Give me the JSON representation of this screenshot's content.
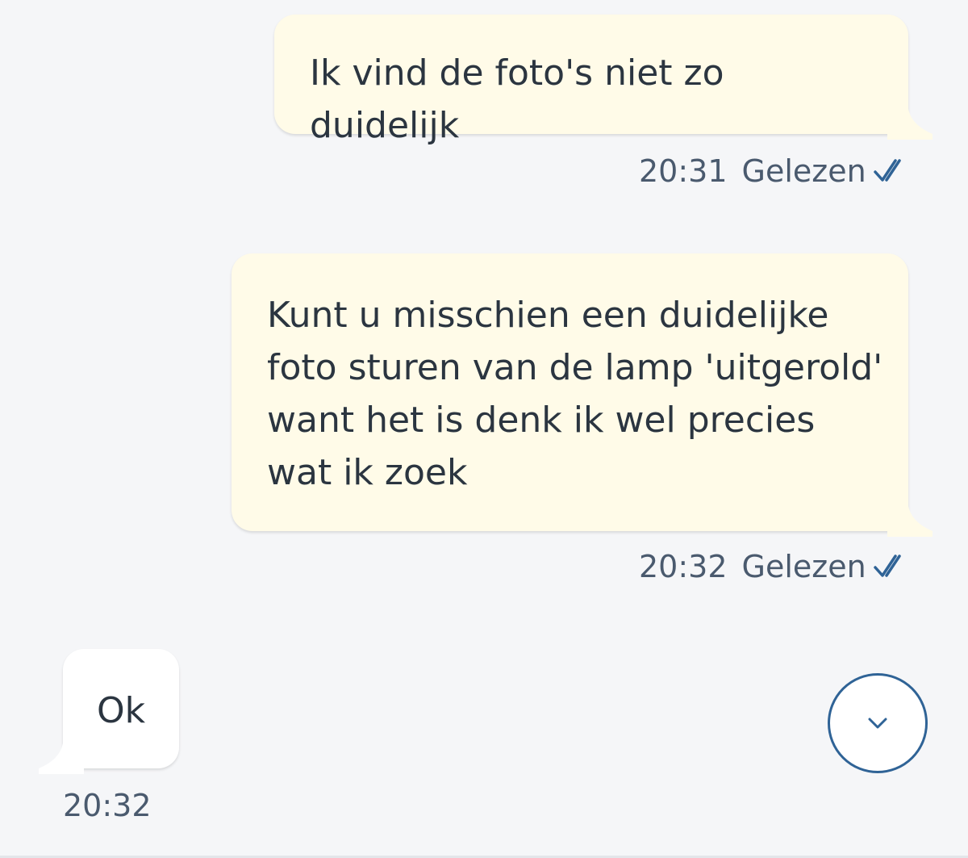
{
  "messages": [
    {
      "direction": "outgoing",
      "text": "Ik vind de foto's niet zo duidelijk",
      "time": "20:31",
      "status": "Gelezen",
      "status_icon": "double-check-icon"
    },
    {
      "direction": "outgoing",
      "text": "Kunt u misschien een duidelijke\nfoto sturen van de lamp 'uitgerold'\nwant het is denk ik wel precies\nwat ik zoek",
      "time": "20:32",
      "status": "Gelezen",
      "status_icon": "double-check-icon"
    },
    {
      "direction": "incoming",
      "text": "Ok",
      "time": "20:32"
    }
  ],
  "scroll_button": {
    "icon": "chevron-down-icon"
  },
  "colors": {
    "background": "#f5f6f8",
    "outgoing_bubble": "#fffbe8",
    "incoming_bubble": "#ffffff",
    "accent": "#2f6396",
    "text": "#2b3540",
    "meta_text": "#4a5a6e"
  }
}
